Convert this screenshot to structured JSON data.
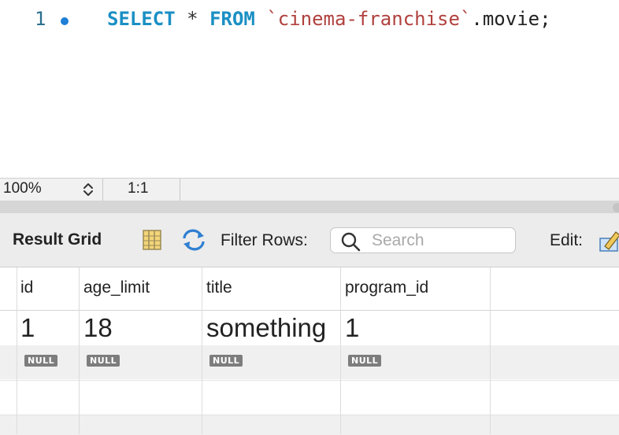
{
  "editor": {
    "line_number": "1",
    "code": {
      "kw_select": "SELECT",
      "star": "*",
      "kw_from": "FROM",
      "schema": "`cinema-franchise`",
      "table": ".movie;"
    }
  },
  "status": {
    "zoom": "100%",
    "cursor_position": "1:1"
  },
  "toolbar": {
    "result_grid_label": "Result Grid",
    "filter_label": "Filter Rows:",
    "search_placeholder": "Search",
    "edit_label": "Edit:"
  },
  "grid": {
    "columns": [
      "id",
      "age_limit",
      "title",
      "program_id"
    ],
    "rows": [
      [
        "1",
        "18",
        "something",
        "1"
      ],
      [
        "NULL",
        "NULL",
        "NULL",
        "NULL"
      ]
    ]
  },
  "colors": {
    "keyword": "#1a8fc4",
    "string": "#b0413e",
    "breakpoint": "#1e7fd6",
    "null_badge": "#7d7d7d"
  }
}
